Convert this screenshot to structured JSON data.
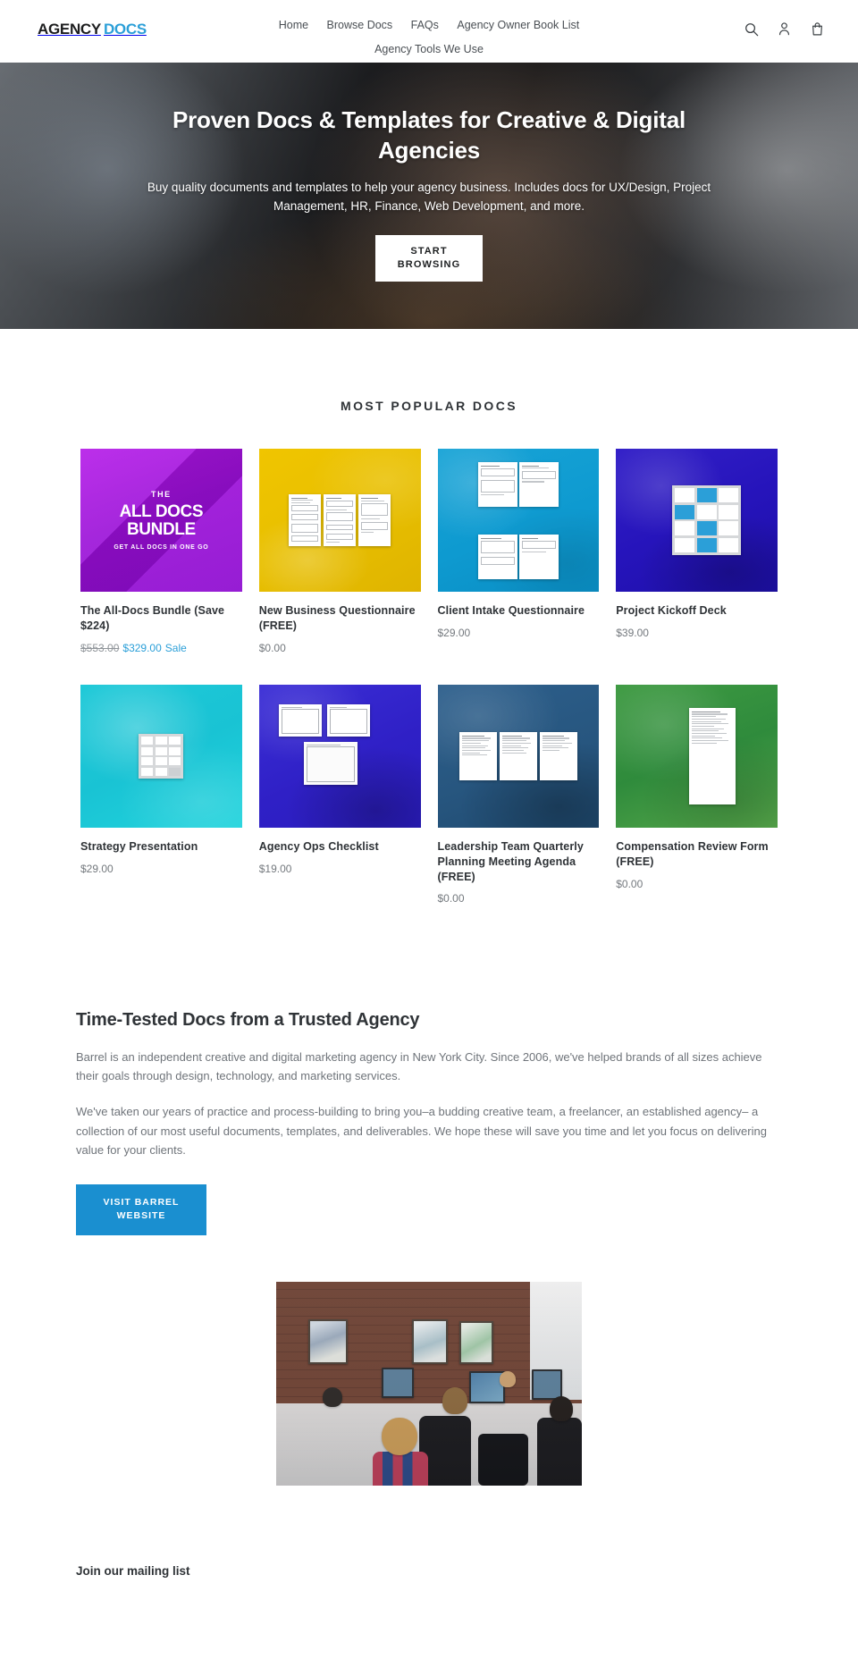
{
  "header": {
    "logo": {
      "part1": "AGENCY",
      "part2": "DOCS"
    },
    "nav": [
      {
        "label": "Home"
      },
      {
        "label": "Browse Docs"
      },
      {
        "label": "FAQs"
      },
      {
        "label": "Agency Owner Book List"
      },
      {
        "label": "Agency Tools We Use"
      }
    ],
    "icons": [
      {
        "name": "search-icon",
        "label": "Search"
      },
      {
        "name": "account-icon",
        "label": "Log in"
      },
      {
        "name": "cart-icon",
        "label": "Cart"
      }
    ]
  },
  "hero": {
    "title": "Proven Docs & Templates for Creative & Digital Agencies",
    "subtitle": "Buy quality documents and templates to help your agency business. Includes docs for UX/Design, Project Management, HR, Finance, Web Development, and more.",
    "cta": "START BROWSING"
  },
  "popular": {
    "title": "MOST POPULAR DOCS",
    "products": [
      {
        "title": "The All-Docs Bundle (Save $224)",
        "price_old": "$553.00",
        "price_new": "$329.00",
        "sale_label": "Sale",
        "art": "bundle",
        "art_text": {
          "t1": "THE",
          "t2": "ALL DOCS",
          "t3": "BUNDLE",
          "t4": "GET ALL DOCS IN ONE GO"
        },
        "color": "#9b0fd8"
      },
      {
        "title": "New Business Questionnaire (FREE)",
        "price": "$0.00",
        "art": "yellow-three-docs",
        "color": "#e8bf00"
      },
      {
        "title": "Client Intake Questionnaire",
        "price": "$29.00",
        "art": "cyan-four-docs",
        "color": "#0e9ad0"
      },
      {
        "title": "Project Kickoff Deck",
        "price": "$39.00",
        "art": "indigo-slide-grid",
        "color": "#2614bb"
      },
      {
        "title": "Strategy Presentation",
        "price": "$29.00",
        "art": "turquoise-slide-grid",
        "color": "#19c3d4"
      },
      {
        "title": "Agency Ops Checklist",
        "price": "$19.00",
        "art": "blue-spreadsheets",
        "color": "#2f20c6"
      },
      {
        "title": "Leadership Team Quarterly Planning Meeting Agenda (FREE)",
        "price": "$0.00",
        "art": "steel-three-docs",
        "color": "#27567f"
      },
      {
        "title": "Compensation Review Form (FREE)",
        "price": "$0.00",
        "art": "green-one-doc",
        "color": "#2f8b3c"
      }
    ]
  },
  "about": {
    "title": "Time-Tested Docs from a Trusted Agency",
    "paragraph1": "Barrel is an independent creative and digital marketing agency in New York City. Since 2006, we've helped brands of all sizes achieve their goals through design, technology, and marketing services.",
    "paragraph2": "We've taken our years of practice and process-building to bring you–a budding creative team, a freelancer, an established agency– a collection of our most useful documents, templates, and deliverables. We hope these will save you time and let you focus on delivering value for your clients.",
    "cta": "VISIT BARREL WEBSITE",
    "cta_color": "#1a8fd0"
  },
  "office_image": {
    "alt": "Barrel agency office with team members at desks"
  },
  "mailing": {
    "title": "Join our mailing list"
  }
}
